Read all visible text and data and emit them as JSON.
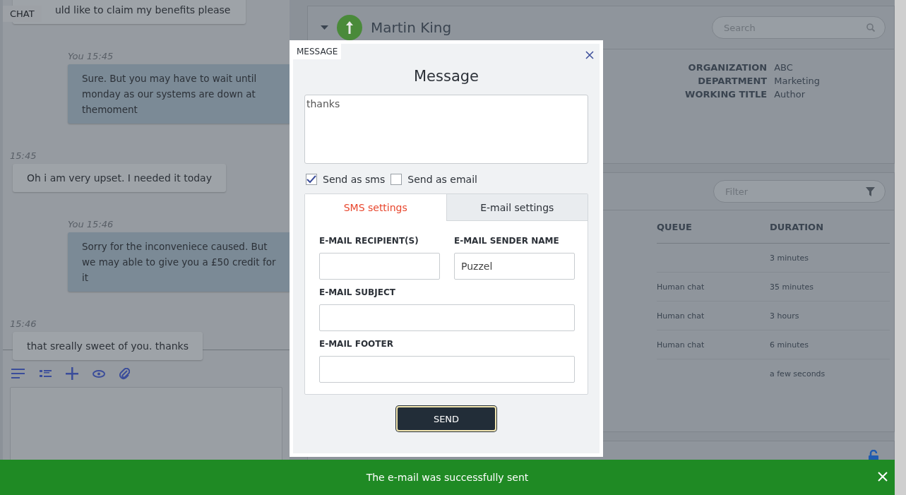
{
  "chat": {
    "label": "CHAT",
    "messages": [
      {
        "kind": "customer",
        "text": "uld like to claim my benefits please"
      },
      {
        "kind": "agent",
        "meta": "You 15:45",
        "text": "Sure. But you may have to wait until monday as our systems are down at themoment"
      },
      {
        "kind": "customer",
        "meta": "15:45",
        "text": "Oh i am very upset. I needed it today"
      },
      {
        "kind": "agent",
        "meta": "You 15:46",
        "text": "Sorry for the inconveniece caused. But we may able to give you a £50 credit for it"
      },
      {
        "kind": "customer",
        "meta": "15:46",
        "text": "that sreally sweet of you. thanks"
      }
    ]
  },
  "contact": {
    "name": "Martin King",
    "search": {
      "placeholder": "Search"
    },
    "details": [
      {
        "label": "ORGANIZATION",
        "value": "ABC"
      },
      {
        "label": "DEPARTMENT",
        "value": "Marketing"
      },
      {
        "label": "WORKING TITLE",
        "value": "Author"
      }
    ],
    "filter": {
      "placeholder": "Filter"
    },
    "table": {
      "columns": [
        "QUEUE",
        "DURATION"
      ],
      "rows": [
        {
          "duration": "3 minutes"
        },
        {
          "queue": "Human chat",
          "duration": "35 minutes"
        },
        {
          "queue": "Human chat",
          "duration": "3 hours"
        },
        {
          "queue": "Human chat",
          "duration": "6 minutes"
        },
        {
          "duration": "a few seconds"
        }
      ]
    }
  },
  "dialog": {
    "tab_label": "MESSAGE",
    "title": "Message",
    "body": "thanks",
    "options": [
      {
        "label": "Send as sms",
        "checked": true
      },
      {
        "label": "Send as email",
        "checked": false
      }
    ],
    "tabs": [
      {
        "label": "SMS settings",
        "selected": true
      },
      {
        "label": "E-mail settings",
        "selected": false
      }
    ],
    "fields": [
      {
        "kind": "half",
        "label": "E-MAIL RECIPIENT(S)"
      },
      {
        "kind": "half",
        "label": "E-MAIL SENDER NAME",
        "value": "Puzzel"
      },
      {
        "kind": "wide",
        "label": "E-MAIL SUBJECT"
      },
      {
        "kind": "wide",
        "label": "E-MAIL FOOTER"
      }
    ],
    "send": "SEND"
  },
  "toast": {
    "text": "The e-mail was successfully sent"
  }
}
